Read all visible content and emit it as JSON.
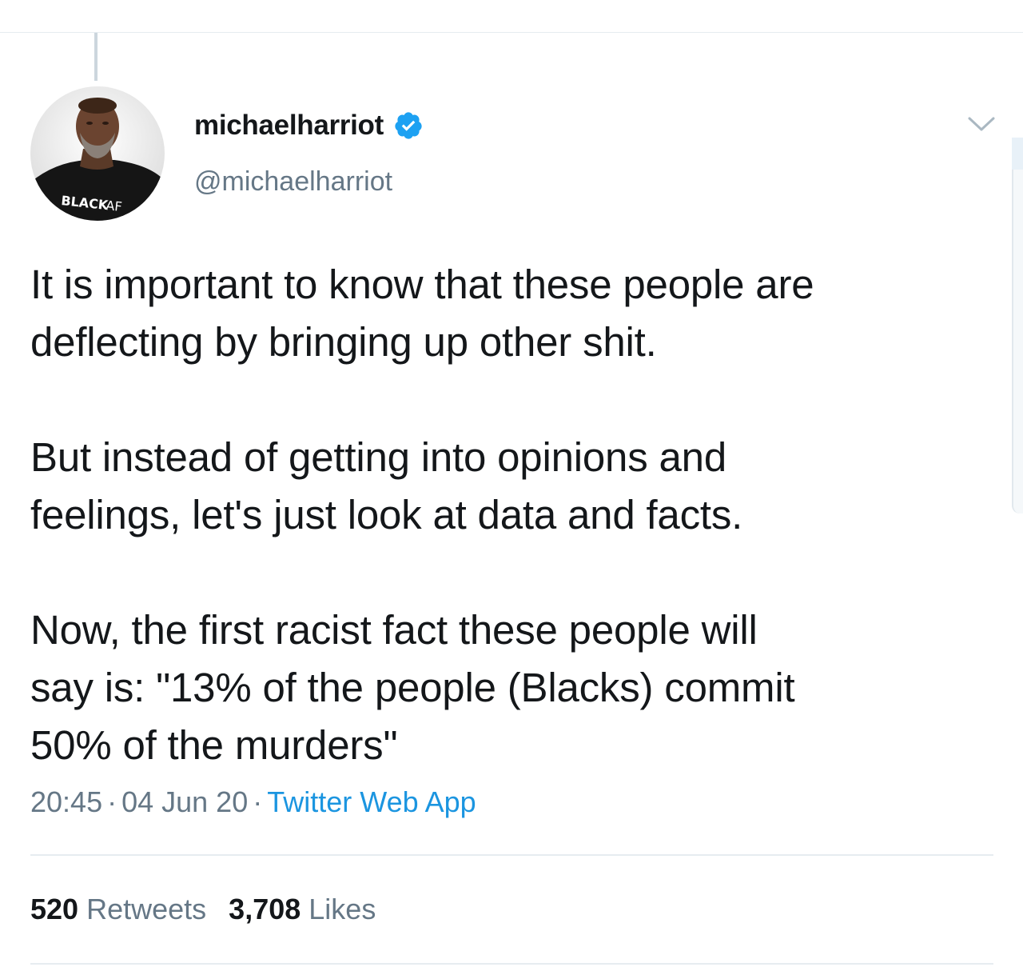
{
  "author": {
    "display_name": "michaelharriot",
    "handle": "@michaelharriot",
    "verified": true,
    "avatar_shirt_text_bold": "BLACK",
    "avatar_shirt_text_light": "AF"
  },
  "icons": {
    "verified": "verified-badge-icon",
    "menu": "chevron-down-icon"
  },
  "tweet": {
    "paragraphs": [
      "It is important to know that these people are\ndeflecting by bringing up other shit.",
      "But instead of getting into opinions and\nfeelings, let's just look at data and facts.",
      "Now, the first racist fact these people will\nsay is: \"13% of the people (Blacks) commit\n50% of the murders\""
    ],
    "time": "20:45",
    "date": "04 Jun 20",
    "separator": "·",
    "source": "Twitter Web App"
  },
  "stats": {
    "retweets_count": "520",
    "retweets_label": "Retweets",
    "likes_count": "3,708",
    "likes_label": "Likes"
  },
  "colors": {
    "text_primary": "#14171a",
    "text_secondary": "#657786",
    "link_blue": "#1b95e0",
    "verified_blue": "#1da1f2",
    "divider": "#e6ecf0"
  }
}
